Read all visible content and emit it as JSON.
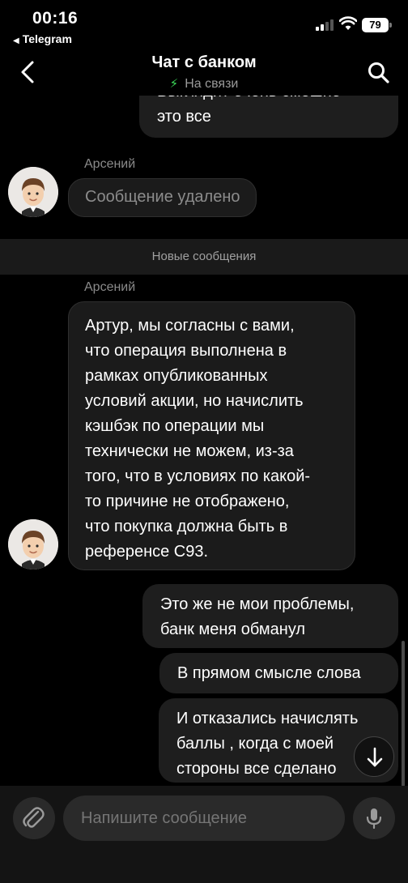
{
  "status_bar": {
    "time": "00:16",
    "back_app": "Telegram",
    "battery": "79"
  },
  "header": {
    "title": "Чат с банком",
    "subtitle": "На связи"
  },
  "messages": [
    {
      "type": "outgoing",
      "text": "Выглядит очень смешно\nэто все"
    },
    {
      "type": "incoming",
      "sender": "Арсений",
      "text": "Сообщение удалено",
      "deleted": true
    },
    {
      "type": "divider",
      "text": "Новые сообщения"
    },
    {
      "type": "incoming",
      "sender": "Арсений",
      "text": "Артур, мы согласны с вами,\nчто операция выполнена в\nрамках опубликованных\nусловий акции, но начислить\nкэшбэк по операции мы\nтехнически не можем, из-за\nтого, что в условиях по какой-\nто причине не отображено,\nчто покупка должна быть в\nреференсе С93."
    },
    {
      "type": "outgoing",
      "text": "Это же не мои проблемы,\nбанк меня обманул"
    },
    {
      "type": "outgoing",
      "text": "В прямом смысле слова"
    },
    {
      "type": "outgoing",
      "text": "И отказались начислять\nбаллы , когда с моей\nстороны все сделано"
    }
  ],
  "composer": {
    "placeholder": "Напишите сообщение"
  },
  "icons": {
    "back": "chevron-left-icon",
    "search": "search-icon",
    "attach": "paperclip-icon",
    "mic": "microphone-icon",
    "scroll_down": "arrow-down-icon",
    "status": "lightning-icon"
  },
  "colors": {
    "background": "#000000",
    "bubble": "#1e1e1e",
    "online": "#3ddc5a"
  }
}
